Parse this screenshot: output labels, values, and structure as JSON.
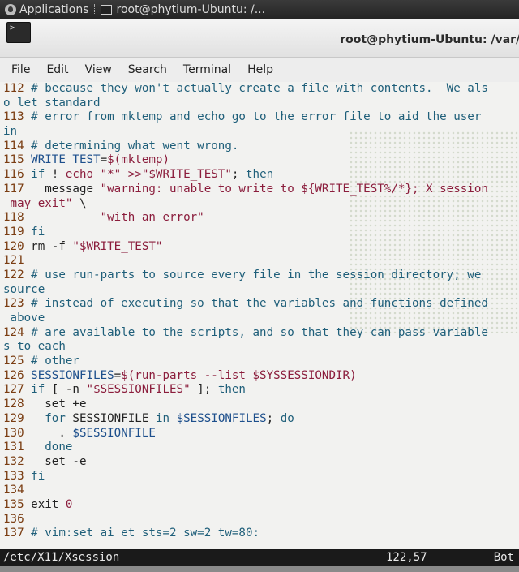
{
  "panel": {
    "applications_label": "Applications",
    "task_label": "root@phytium-Ubuntu: /..."
  },
  "window": {
    "title": "root@phytium-Ubuntu: /var/l",
    "icon_glyph": ">_"
  },
  "menubar": {
    "items": [
      "File",
      "Edit",
      "View",
      "Search",
      "Terminal",
      "Help"
    ]
  },
  "editor": {
    "lines": [
      [
        {
          "c": "ln",
          "t": "112 "
        },
        {
          "c": "cmt",
          "t": "# because they won't actually create a file with contents.  We als"
        }
      ],
      [
        {
          "c": "cmt",
          "t": "o let standard"
        }
      ],
      [
        {
          "c": "ln",
          "t": "113 "
        },
        {
          "c": "cmt",
          "t": "# error from mktemp and echo go to the error file to aid the user"
        }
      ],
      [
        {
          "c": "cmt",
          "t": "in"
        }
      ],
      [
        {
          "c": "ln",
          "t": "114 "
        },
        {
          "c": "cmt",
          "t": "# determining what went wrong."
        }
      ],
      [
        {
          "c": "ln",
          "t": "115 "
        },
        {
          "c": "var",
          "t": "WRITE_TEST"
        },
        {
          "c": "plain",
          "t": "="
        },
        {
          "c": "str",
          "t": "$(mktemp)"
        }
      ],
      [
        {
          "c": "ln",
          "t": "116 "
        },
        {
          "c": "kw",
          "t": "if"
        },
        {
          "c": "plain",
          "t": " ! "
        },
        {
          "c": "str",
          "t": "echo \"*\" >>\"$WRITE_TEST\""
        },
        {
          "c": "plain",
          "t": "; "
        },
        {
          "c": "kw",
          "t": "then"
        }
      ],
      [
        {
          "c": "ln",
          "t": "117 "
        },
        {
          "c": "plain",
          "t": "  message "
        },
        {
          "c": "str",
          "t": "\"warning: unable to write to ${WRITE_TEST%/*}; X session"
        }
      ],
      [
        {
          "c": "str",
          "t": " may exit\""
        },
        {
          "c": "plain",
          "t": " \\"
        }
      ],
      [
        {
          "c": "ln",
          "t": "118 "
        },
        {
          "c": "str",
          "t": "          \"with an error\""
        }
      ],
      [
        {
          "c": "ln",
          "t": "119 "
        },
        {
          "c": "kw",
          "t": "fi"
        }
      ],
      [
        {
          "c": "ln",
          "t": "120 "
        },
        {
          "c": "plain",
          "t": "rm -f "
        },
        {
          "c": "str",
          "t": "\"$WRITE_TEST\""
        }
      ],
      [
        {
          "c": "ln",
          "t": "121 "
        }
      ],
      [
        {
          "c": "ln",
          "t": "122 "
        },
        {
          "c": "cmt",
          "t": "# use run-parts to source every file in the session directory; we"
        }
      ],
      [
        {
          "c": "cmt",
          "t": "source"
        }
      ],
      [
        {
          "c": "ln",
          "t": "123 "
        },
        {
          "c": "cmt",
          "t": "# instead of executing so that the variables and functions defined"
        }
      ],
      [
        {
          "c": "cmt",
          "t": " above"
        }
      ],
      [
        {
          "c": "ln",
          "t": "124 "
        },
        {
          "c": "cmt",
          "t": "# are available to the scripts, and so that they can pass variable"
        }
      ],
      [
        {
          "c": "cmt",
          "t": "s to each"
        }
      ],
      [
        {
          "c": "ln",
          "t": "125 "
        },
        {
          "c": "cmt",
          "t": "# other"
        }
      ],
      [
        {
          "c": "ln",
          "t": "126 "
        },
        {
          "c": "var",
          "t": "SESSIONFILES"
        },
        {
          "c": "plain",
          "t": "="
        },
        {
          "c": "str",
          "t": "$(run-parts --list $SYSSESSIONDIR)"
        }
      ],
      [
        {
          "c": "ln",
          "t": "127 "
        },
        {
          "c": "kw",
          "t": "if"
        },
        {
          "c": "plain",
          "t": " [ -n "
        },
        {
          "c": "str",
          "t": "\"$SESSIONFILES\""
        },
        {
          "c": "plain",
          "t": " ]; "
        },
        {
          "c": "kw",
          "t": "then"
        }
      ],
      [
        {
          "c": "ln",
          "t": "128 "
        },
        {
          "c": "plain",
          "t": "  set +e"
        }
      ],
      [
        {
          "c": "ln",
          "t": "129 "
        },
        {
          "c": "plain",
          "t": "  "
        },
        {
          "c": "kw",
          "t": "for"
        },
        {
          "c": "plain",
          "t": " SESSIONFILE "
        },
        {
          "c": "kw",
          "t": "in"
        },
        {
          "c": "var",
          "t": " $SESSIONFILES"
        },
        {
          "c": "plain",
          "t": "; "
        },
        {
          "c": "kw",
          "t": "do"
        }
      ],
      [
        {
          "c": "ln",
          "t": "130 "
        },
        {
          "c": "plain",
          "t": "    . "
        },
        {
          "c": "var",
          "t": "$SESSIONFILE"
        }
      ],
      [
        {
          "c": "ln",
          "t": "131 "
        },
        {
          "c": "plain",
          "t": "  "
        },
        {
          "c": "kw",
          "t": "done"
        }
      ],
      [
        {
          "c": "ln",
          "t": "132 "
        },
        {
          "c": "plain",
          "t": "  set -e"
        }
      ],
      [
        {
          "c": "ln",
          "t": "133 "
        },
        {
          "c": "kw",
          "t": "fi"
        }
      ],
      [
        {
          "c": "ln",
          "t": "134 "
        }
      ],
      [
        {
          "c": "ln",
          "t": "135 "
        },
        {
          "c": "plain",
          "t": "exit "
        },
        {
          "c": "num",
          "t": "0"
        }
      ],
      [
        {
          "c": "ln",
          "t": "136 "
        }
      ],
      [
        {
          "c": "ln",
          "t": "137 "
        },
        {
          "c": "cmt",
          "t": "# vim:set ai et sts=2 sw=2 tw=80:"
        }
      ]
    ]
  },
  "statusline": {
    "filename": "/etc/X11/Xsession",
    "position": "122,57",
    "scroll": "Bot"
  }
}
